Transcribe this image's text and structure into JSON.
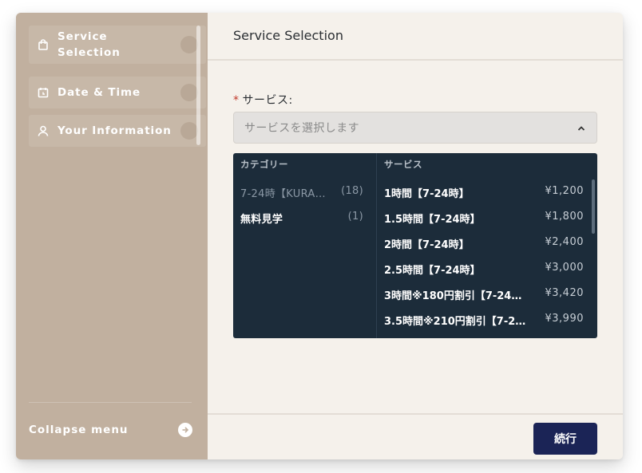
{
  "sidebar": {
    "items": [
      {
        "label": "Service\nSelection",
        "icon": "shopping-bag-icon"
      },
      {
        "label": "Date & Time",
        "icon": "calendar-clock-icon"
      },
      {
        "label": "Your Information",
        "icon": "user-icon"
      }
    ],
    "collapse_label": "Collapse menu"
  },
  "main": {
    "title": "Service Selection",
    "service_field": {
      "label": "サービス:",
      "required_mark": "*",
      "placeholder": "サービスを選択します"
    },
    "dropdown": {
      "category_header": "カテゴリー",
      "service_header": "サービス",
      "categories": [
        {
          "name": "7-24時【KURA…",
          "count": "(18)"
        },
        {
          "name": "無料見学",
          "count": "(1)"
        }
      ],
      "services": [
        {
          "name": "1時間【7-24時】",
          "price": "¥1,200"
        },
        {
          "name": "1.5時間【7-24時】",
          "price": "¥1,800"
        },
        {
          "name": "2時間【7-24時】",
          "price": "¥2,400"
        },
        {
          "name": "2.5時間【7-24時】",
          "price": "¥3,000"
        },
        {
          "name": "3時間※180円割引【7-24…",
          "price": "¥3,420"
        },
        {
          "name": "3.5時間※210円割引【7-2…",
          "price": "¥3,990"
        }
      ]
    },
    "continue_label": "続行"
  },
  "colors": {
    "sidebar_bg": "#c1b09f",
    "main_bg": "#f5f1eb",
    "dropdown_bg": "#1c2c3a",
    "button_bg": "#1b2456",
    "required": "#c0392b"
  }
}
